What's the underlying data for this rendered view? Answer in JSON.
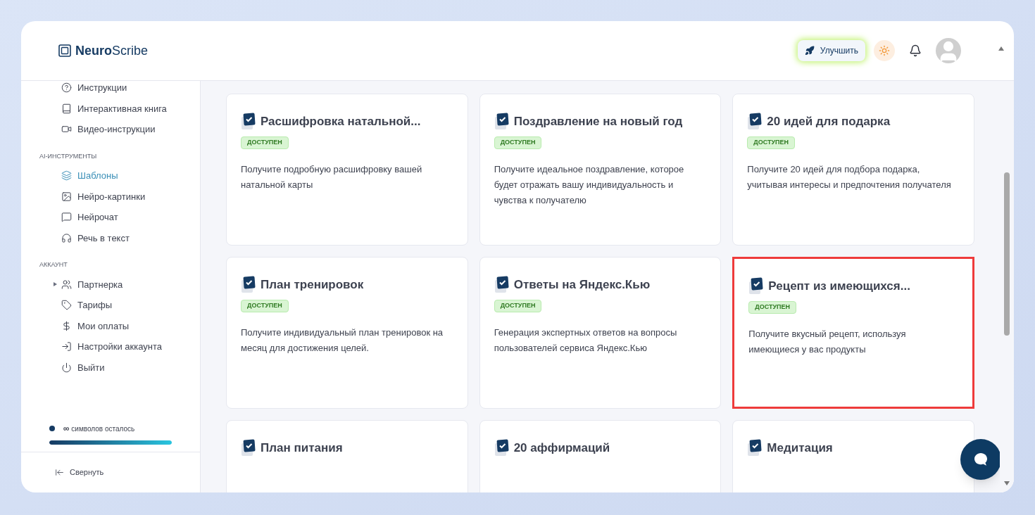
{
  "header": {
    "logo": {
      "bold": "Neuro",
      "rest": "Scribe"
    },
    "upgrade_button": "Улучшить"
  },
  "sidebar": {
    "sections": [
      {
        "items": [
          {
            "label": "Инструкции",
            "kind": "link",
            "selected": false
          },
          {
            "label": "Интерактивная книга",
            "kind": "link",
            "selected": false
          },
          {
            "label": "Видео-инструкции",
            "kind": "link",
            "selected": false
          }
        ]
      },
      {
        "title": "AI-ИНСТРУМЕНТЫ",
        "items": [
          {
            "label": "Шаблоны",
            "kind": "link",
            "selected": true
          },
          {
            "label": "Нейро-картинки",
            "kind": "link",
            "selected": false
          },
          {
            "label": "Нейрочат",
            "kind": "link",
            "selected": false
          },
          {
            "label": "Речь в текст",
            "kind": "link",
            "selected": false
          }
        ]
      },
      {
        "title": "АККАУНТ",
        "items": [
          {
            "label": "Партнерка",
            "kind": "group",
            "expanded": false,
            "selected": false
          },
          {
            "label": "Тарифы",
            "kind": "link",
            "selected": false
          },
          {
            "label": "Мои оплаты",
            "kind": "link",
            "selected": false
          },
          {
            "label": "Настройки аккаунта",
            "kind": "link",
            "selected": false
          },
          {
            "label": "Выйти",
            "kind": "link",
            "selected": false
          }
        ]
      }
    ],
    "usage": {
      "amount": "∞",
      "label": "символов осталось",
      "level": 1
    },
    "collapse": "Свернуть"
  },
  "templates": [
    {
      "title": "Расшифровка натальной...",
      "badge": "ДОСТУПЕН",
      "description": "Получите подробную расшифровку вашей натальной карты",
      "highlighted": false
    },
    {
      "title": "Поздравление на новый год",
      "badge": "ДОСТУПЕН",
      "description": "Получите идеальное поздравление, которое будет отражать вашу индивидуальность и чувства к получателю",
      "highlighted": false
    },
    {
      "title": "20 идей для подарка",
      "badge": "ДОСТУПЕН",
      "description": "Получите 20 идей для подбора подарка, учитывая интересы и предпочтения получателя",
      "highlighted": false
    },
    {
      "title": "План тренировок",
      "badge": "ДОСТУПЕН",
      "description": "Получите индивидуальный план тренировок на месяц для достижения целей.",
      "highlighted": false
    },
    {
      "title": "Ответы на Яндекс.Кью",
      "badge": "ДОСТУПЕН",
      "description": "Генерация экспертных ответов на вопросы пользователей сервиса Яндекс.Кью",
      "highlighted": false
    },
    {
      "title": "Рецепт из имеющихся...",
      "badge": "ДОСТУПЕН",
      "description": "Получите вкусный рецепт, используя имеющиеся у вас продукты",
      "highlighted": true
    },
    {
      "title": "План питания",
      "highlighted": false
    },
    {
      "title": "20 аффирмаций",
      "highlighted": false
    },
    {
      "title": "Медитация",
      "highlighted": false
    }
  ]
}
